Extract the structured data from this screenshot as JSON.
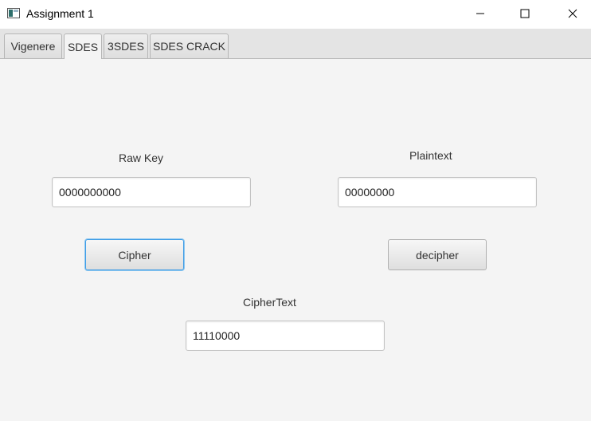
{
  "window": {
    "title": "Assignment 1"
  },
  "tabs": [
    {
      "label": "Vigenere",
      "selected": false
    },
    {
      "label": "SDES",
      "selected": true
    },
    {
      "label": "3SDES",
      "selected": false
    },
    {
      "label": "SDES CRACK",
      "selected": false
    }
  ],
  "sdes": {
    "raw_key_label": "Raw Key",
    "raw_key_value": "0000000000",
    "plaintext_label": "Plaintext",
    "plaintext_value": "00000000",
    "cipher_button": "Cipher",
    "decipher_button": "decipher",
    "ciphertext_label": "CipherText",
    "ciphertext_value": "11110000"
  },
  "colors": {
    "focus_ring": "#3e9ce6",
    "background": "#f4f4f4"
  },
  "icons": {
    "app": "app-window-icon",
    "minimize": "minimize-icon",
    "maximize": "maximize-icon",
    "close": "close-icon"
  }
}
